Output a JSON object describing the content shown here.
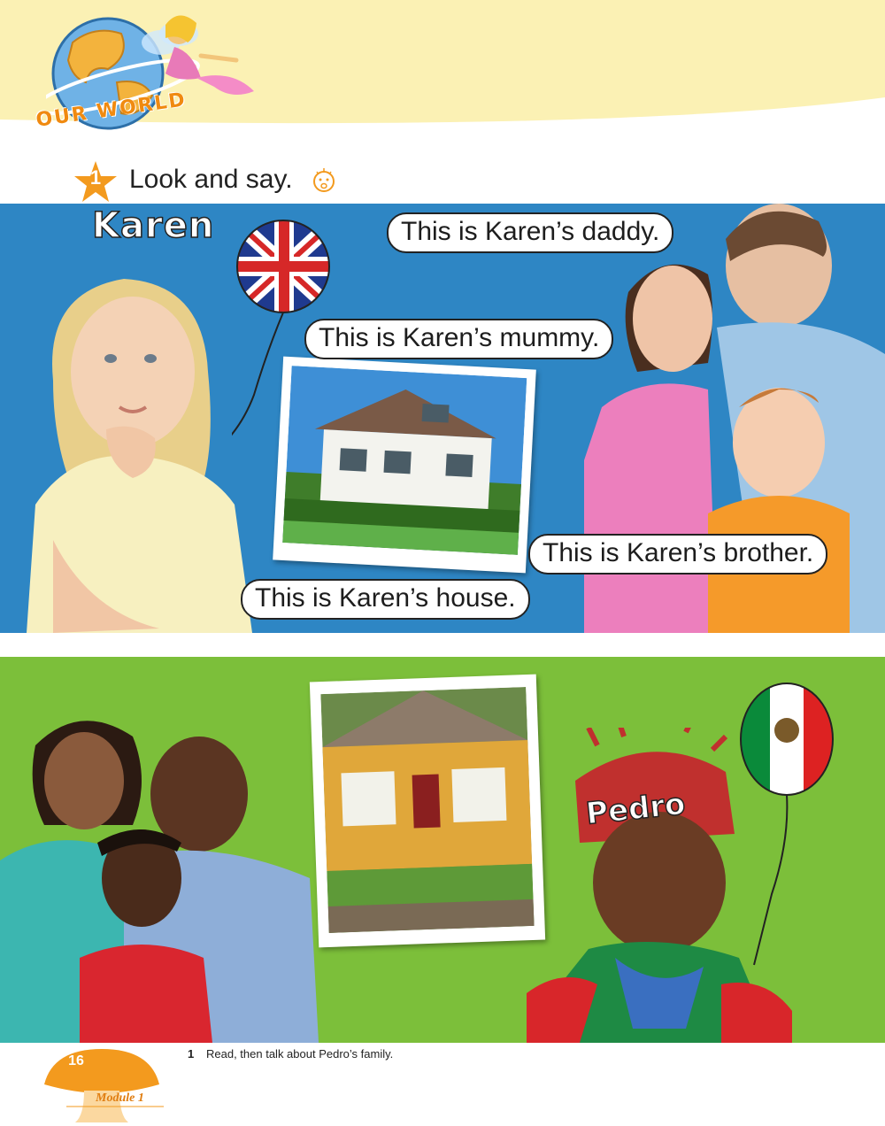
{
  "header": {
    "logo_text": "OUR WORLD",
    "band_color": "#fbf1b4"
  },
  "exercise": {
    "number": "1",
    "title": "Look and say.",
    "speak_icon": "speaking-face-icon"
  },
  "karen_panel": {
    "name": "Karen",
    "flag": "union-jack-balloon",
    "bubbles": {
      "daddy": "This is Karen’s daddy.",
      "mummy": "This is Karen’s mummy.",
      "brother": "This is Karen’s brother.",
      "house": "This is Karen’s house."
    },
    "bg_color": "#2e86c4"
  },
  "pedro_panel": {
    "name": "Pedro",
    "flag": "mexico-flag-balloon",
    "bg_color": "#7cbf3a"
  },
  "footer": {
    "note_number": "1",
    "note_text": "Read, then talk about Pedro’s family.",
    "page_number": "16",
    "module": "Module 1",
    "accent": "#f39a1e"
  }
}
